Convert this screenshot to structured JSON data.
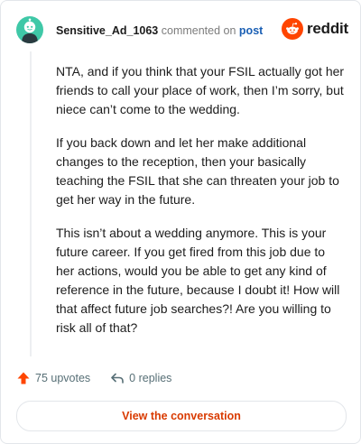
{
  "header": {
    "author": "Sensitive_Ad_1063",
    "commented_on": "commented on",
    "post_link": "post"
  },
  "logo": {
    "text": "reddit",
    "icon": "reddit-snoo-icon",
    "color": "#ff4500"
  },
  "avatar": {
    "icon": "snoo-avatar-icon",
    "color": "#3fc8a7"
  },
  "comment": {
    "paragraphs": [
      "NTA, and if you think that your FSIL actually got her friends to call your place of work, then I’m sorry, but niece can’t come to the wedding.",
      "If you back down and let her make additional changes to the reception, then your basically teaching the FSIL that she can threaten your job to get her way in the future.",
      "This isn’t about a wedding anymore. This is your future career. If you get fired from this job due to her actions, would you be able to get any kind of reference in the future, because I doubt it! How will that affect future job searches?! Are you willing to risk all of that?"
    ]
  },
  "actions": {
    "upvotes": "75 upvotes",
    "replies": "0 replies",
    "upvote_icon": "upvote-arrow-icon",
    "reply_icon": "reply-arrow-icon",
    "upvote_color": "#ff4500"
  },
  "cta": {
    "label": "View the conversation",
    "color": "#d93a00"
  }
}
